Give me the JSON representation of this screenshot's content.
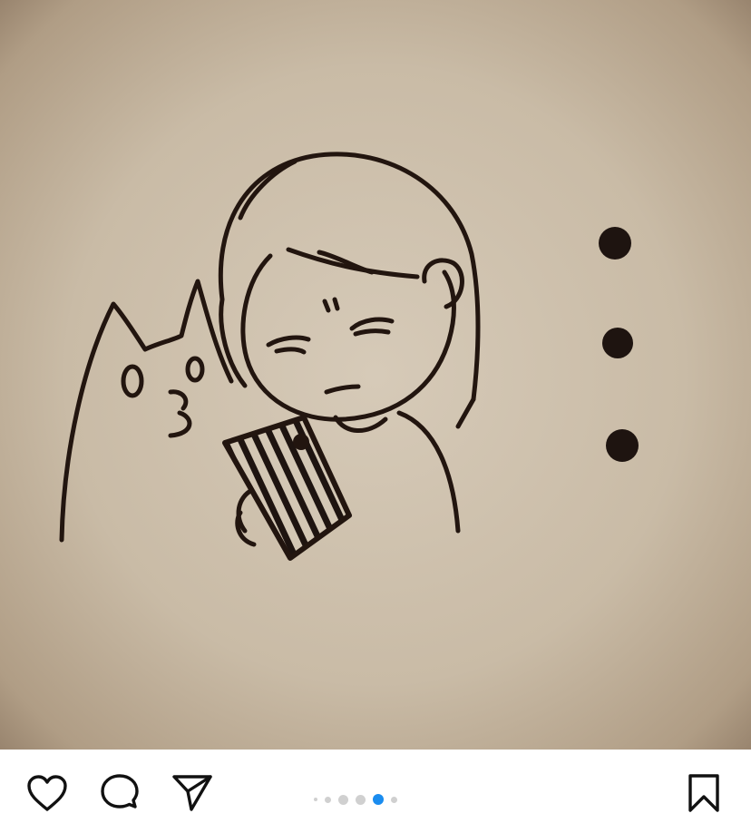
{
  "post": {
    "image": {
      "subject": "ink-drawing-girl-with-phone-and-cat"
    },
    "carousel": {
      "total": 6,
      "current_index": 4,
      "active_color": "#1a8cef",
      "inactive_color": "#d0d0d0"
    },
    "actions": {
      "like_icon": "heart-icon",
      "comment_icon": "comment-bubble-icon",
      "share_icon": "paper-plane-icon",
      "save_icon": "bookmark-icon"
    }
  }
}
